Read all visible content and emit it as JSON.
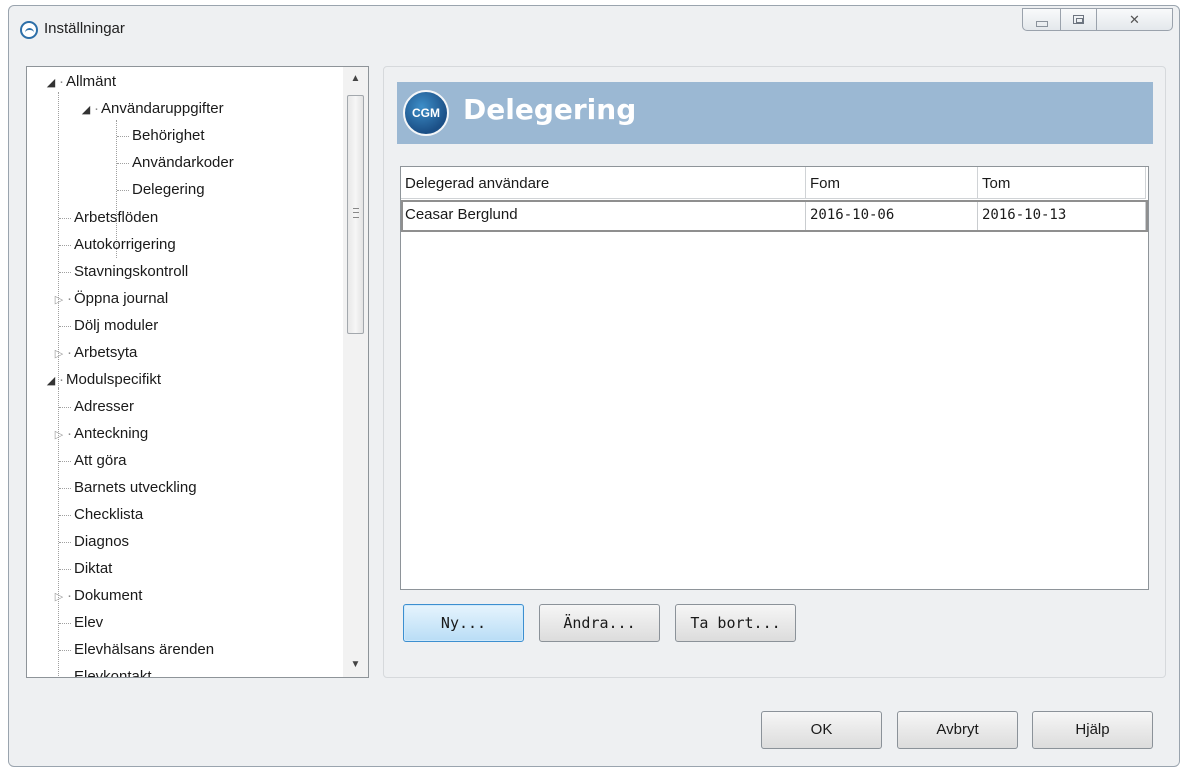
{
  "window": {
    "title": "Inställningar"
  },
  "tree": {
    "items": [
      {
        "label": "Allmänt",
        "expander": "expanded"
      },
      {
        "label": "Användaruppgifter",
        "expander": "expanded"
      },
      {
        "label": "Behörighet",
        "expander": "none"
      },
      {
        "label": "Användarkoder",
        "expander": "none"
      },
      {
        "label": "Delegering",
        "expander": "none"
      },
      {
        "label": "Arbetsflöden",
        "expander": "none"
      },
      {
        "label": "Autokorrigering",
        "expander": "none"
      },
      {
        "label": "Stavningskontroll",
        "expander": "none"
      },
      {
        "label": "Öppna journal",
        "expander": "collapsed"
      },
      {
        "label": "Dölj moduler",
        "expander": "none"
      },
      {
        "label": "Arbetsyta",
        "expander": "collapsed"
      },
      {
        "label": "Modulspecifikt",
        "expander": "expanded"
      },
      {
        "label": "Adresser",
        "expander": "none"
      },
      {
        "label": "Anteckning",
        "expander": "collapsed"
      },
      {
        "label": "Att göra",
        "expander": "none"
      },
      {
        "label": "Barnets utveckling",
        "expander": "none"
      },
      {
        "label": "Checklista",
        "expander": "none"
      },
      {
        "label": "Diagnos",
        "expander": "none"
      },
      {
        "label": "Diktat",
        "expander": "none"
      },
      {
        "label": "Dokument",
        "expander": "collapsed"
      },
      {
        "label": "Elev",
        "expander": "none"
      },
      {
        "label": "Elevhälsans ärenden",
        "expander": "none"
      },
      {
        "label": "Elevkontakt",
        "expander": "none"
      }
    ]
  },
  "panel": {
    "logo_text": "CGM",
    "title": "Delegering"
  },
  "grid": {
    "columns": [
      "Delegerad användare",
      "Fom",
      "Tom"
    ],
    "rows": [
      [
        "Ceasar Berglund",
        "2016-10-06",
        "2016-10-13"
      ]
    ]
  },
  "actions": {
    "new": "Ny...",
    "edit": "Ändra...",
    "delete": "Ta bort..."
  },
  "footer": {
    "ok": "OK",
    "cancel": "Avbryt",
    "help": "Hjälp"
  },
  "colors": {
    "header_banner": "#9bb8d3",
    "primary_button": "#b9ddf6"
  }
}
